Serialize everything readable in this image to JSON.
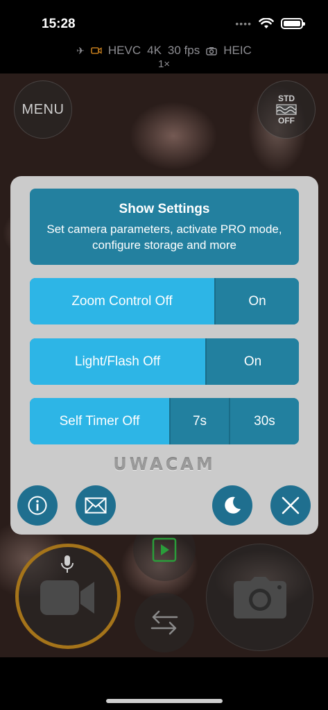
{
  "status_bar": {
    "time": "15:28",
    "icons": [
      "signal-dots-icon",
      "wifi-icon",
      "battery-icon"
    ]
  },
  "camera_info": {
    "icons": [
      "airplane-icon",
      "video-camera-icon",
      "photo-camera-icon"
    ],
    "codec": "HEVC",
    "resolution": "4K",
    "fps": "30 fps",
    "photo_format": "HEIC",
    "zoom": "1×"
  },
  "viewfinder": {
    "menu_label": "MENU",
    "std_top": "STD",
    "std_bottom": "OFF"
  },
  "panel": {
    "settings": {
      "title": "Show Settings",
      "subtitle": "Set camera parameters, activate PRO mode, configure storage and more"
    },
    "zoom_control": {
      "off_label": "Zoom Control Off",
      "on_label": "On"
    },
    "light_flash": {
      "off_label": "Light/Flash Off",
      "on_label": "On"
    },
    "self_timer": {
      "off_label": "Self Timer Off",
      "option1": "7s",
      "option2": "30s"
    },
    "logo_text": "UWACAM"
  },
  "colors": {
    "panel_bg": "#cbcbcb",
    "active_segment": "#2db5e6",
    "inactive_segment": "#22809f",
    "record_ring": "#a5741a",
    "play_icon": "#2a9d3a"
  }
}
